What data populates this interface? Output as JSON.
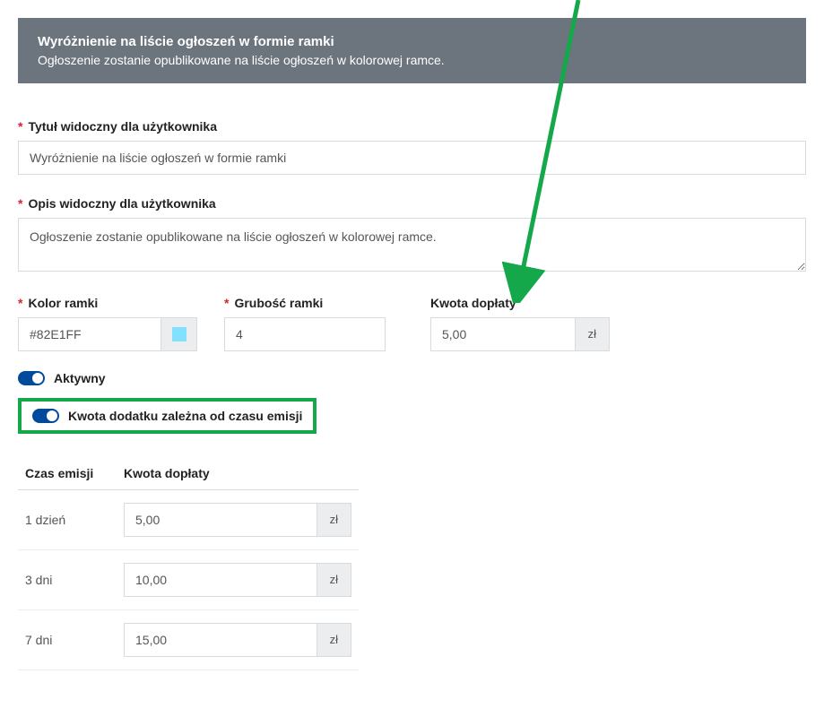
{
  "header": {
    "title": "Wyróżnienie na liście ogłoszeń w formie ramki",
    "subtitle": "Ogłoszenie zostanie opublikowane na liście ogłoszeń w kolorowej ramce."
  },
  "labels": {
    "user_title": "Tytuł widoczny dla użytkownika",
    "user_desc": "Opis widoczny dla użytkownika",
    "frame_color": "Kolor ramki",
    "frame_thickness": "Grubość ramki",
    "surcharge": "Kwota dopłaty",
    "active": "Aktywny",
    "depends_on_time": "Kwota dodatku zależna od czasu emisji",
    "emission_time": "Czas emisji",
    "currency": "zł"
  },
  "values": {
    "user_title": "Wyróżnienie na liście ogłoszeń w formie ramki",
    "user_desc": "Ogłoszenie zostanie opublikowane na liście ogłoszeń w kolorowej ramce.",
    "frame_color": "#82E1FF",
    "frame_thickness": "4",
    "surcharge": "5,00"
  },
  "colors": {
    "swatch": "#82E1FF",
    "highlight_border": "#14a84a",
    "arrow": "#14a84a"
  },
  "table": {
    "rows": [
      {
        "time": "1 dzień",
        "amount": "5,00"
      },
      {
        "time": "3 dni",
        "amount": "10,00"
      },
      {
        "time": "7 dni",
        "amount": "15,00"
      }
    ]
  }
}
